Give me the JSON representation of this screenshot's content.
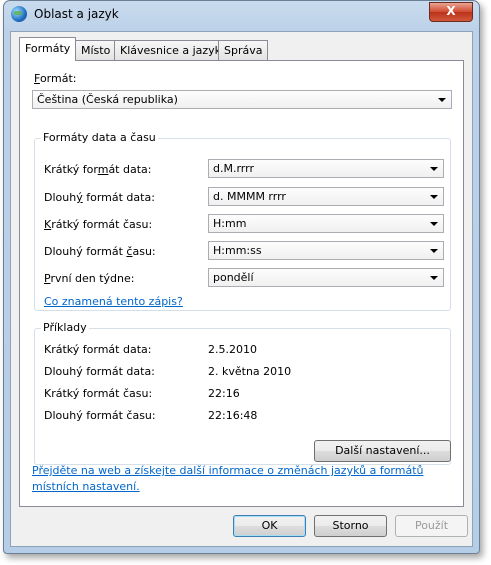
{
  "window": {
    "title": "Oblast a jazyk",
    "close_glyph": "X"
  },
  "tabs": [
    {
      "label": "Formáty",
      "active": true
    },
    {
      "label": "Místo"
    },
    {
      "label": "Klávesnice a jazyky"
    },
    {
      "label": "Správa"
    }
  ],
  "format": {
    "label_u": "F",
    "label_rest": "ormát:",
    "value": "Čeština (Česká republika)"
  },
  "datetime_group": {
    "title": "Formáty data a času",
    "rows": [
      {
        "label_pre": "Krátký for",
        "label_u": "m",
        "label_post": "át data:",
        "value": "d.M.rrrr"
      },
      {
        "label_pre": "Dlouh",
        "label_u": "ý",
        "label_post": " formát data:",
        "value": "d. MMMM rrrr"
      },
      {
        "label_pre": "",
        "label_u": "K",
        "label_post": "rátký formát času:",
        "value": "H:mm"
      },
      {
        "label_pre": "Dlouhý formát ",
        "label_u": "č",
        "label_post": "asu:",
        "value": "H:mm:ss"
      },
      {
        "label_pre": "",
        "label_u": "P",
        "label_post": "rvní den týdne:",
        "value": "pondělí"
      }
    ],
    "help_link": "Co znamená tento zápis?"
  },
  "examples": {
    "title": "Příklady",
    "rows": [
      {
        "label": "Krátký formát data:",
        "value": "2.5.2010"
      },
      {
        "label": "Dlouhý formát data:",
        "value": "2. května 2010"
      },
      {
        "label": "Krátký formát času:",
        "value": "22:16"
      },
      {
        "label": "Dlouhý formát času:",
        "value": "22:16:48"
      }
    ]
  },
  "more_settings_button": "Další nastavení...",
  "web_link": {
    "line1": "Přejděte na web a získejte další informace o změnách jazyků a formátů",
    "line2": "místních nastavení."
  },
  "footer": {
    "ok": "OK",
    "cancel": "Storno",
    "apply": "Použít"
  }
}
